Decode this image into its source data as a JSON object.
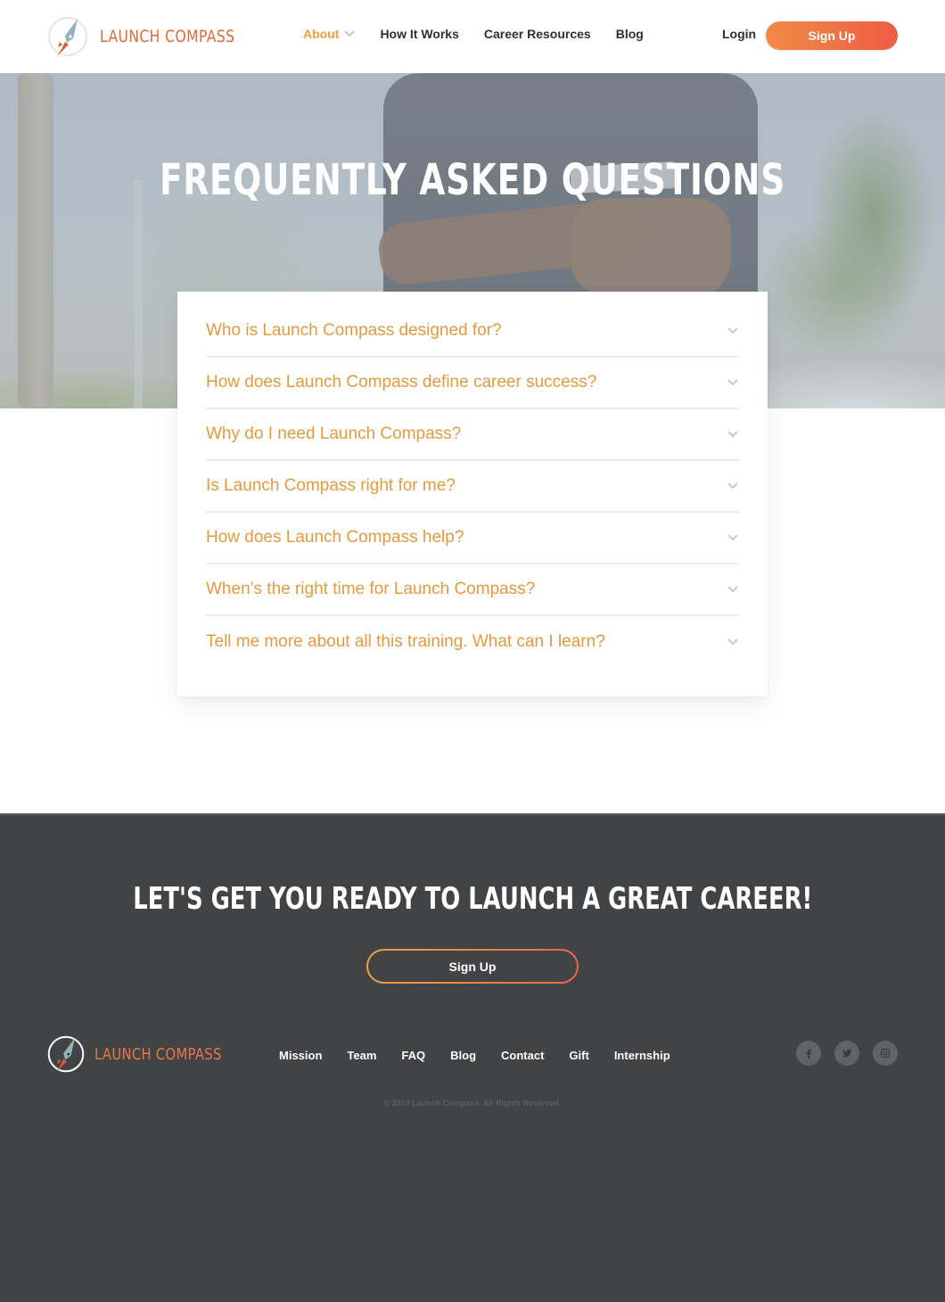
{
  "brand": {
    "name": "LAUNCH COMPASS",
    "colors": {
      "accent_orange": "#e59a3d",
      "logo_orange": "#e06a3a",
      "button_gradient_start": "#f08b46",
      "button_gradient_end": "#ee5e44",
      "footer_bg": "#424345",
      "logo_needle": "#8fb4bd"
    }
  },
  "header": {
    "nav": [
      {
        "label": "About",
        "active": true,
        "has_dropdown": true,
        "icon": "chevron-down-icon"
      },
      {
        "label": "How It Works"
      },
      {
        "label": "Career Resources"
      },
      {
        "label": "Blog"
      }
    ],
    "login_label": "Login",
    "signup_label": "Sign Up"
  },
  "hero": {
    "title": "FREQUENTLY ASKED QUESTIONS"
  },
  "faq": {
    "items": [
      {
        "question": "Who is Launch Compass designed for?",
        "icon": "chevron-down-icon"
      },
      {
        "question": "How does Launch Compass define career success?",
        "icon": "chevron-down-icon"
      },
      {
        "question": "Why do I need Launch Compass?",
        "icon": "chevron-down-icon"
      },
      {
        "question": "Is Launch Compass right for me?",
        "icon": "chevron-down-icon"
      },
      {
        "question": "How does Launch Compass help?",
        "icon": "chevron-down-icon"
      },
      {
        "question": "When’s the right time for Launch Compass?",
        "icon": "chevron-down-icon"
      },
      {
        "question": "Tell me more about all this training. What can I learn?",
        "icon": "chevron-down-icon"
      }
    ]
  },
  "cta": {
    "title": "LET'S GET YOU READY TO LAUNCH A GREAT CAREER!",
    "button_label": "Sign Up"
  },
  "footer": {
    "brand_name": "LAUNCH COMPASS",
    "links": [
      "Mission",
      "Team",
      "FAQ",
      "Blog",
      "Contact",
      "Gift",
      "Internship"
    ],
    "social": [
      {
        "name": "facebook",
        "icon": "facebook-icon"
      },
      {
        "name": "twitter",
        "icon": "twitter-icon"
      },
      {
        "name": "instagram",
        "icon": "instagram-icon"
      }
    ],
    "copyright": "© 2019 Launch Compass. All Rights Reserved."
  }
}
